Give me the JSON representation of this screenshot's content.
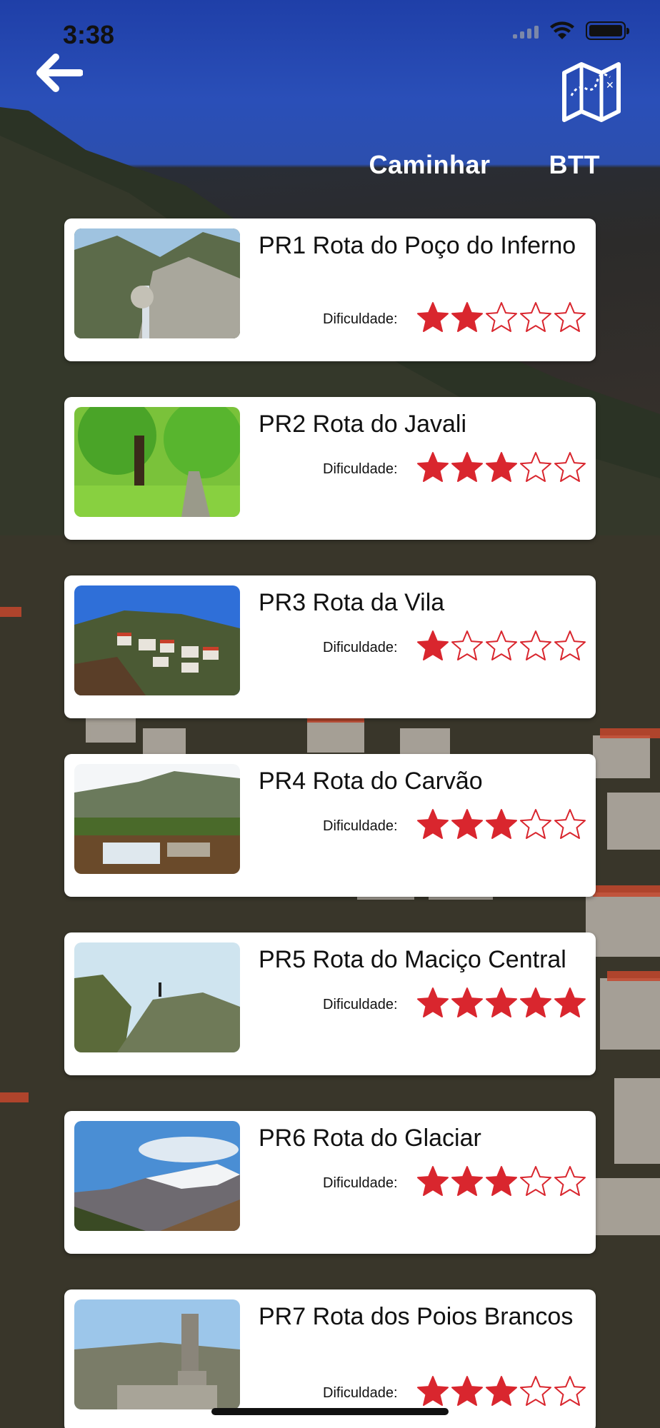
{
  "status": {
    "time": "3:38"
  },
  "nav": {
    "back_icon": "arrow-left-icon",
    "map_icon": "folded-map-icon",
    "tabs": [
      "Caminhar",
      "BTT"
    ]
  },
  "routes": [
    {
      "title": "PR1 Rota do Poço do Inferno",
      "difficulty_label": "Dificuldade:",
      "difficulty": 2,
      "max_difficulty": 5
    },
    {
      "title": "PR2 Rota do Javali",
      "difficulty_label": "Dificuldade:",
      "difficulty": 3,
      "max_difficulty": 5
    },
    {
      "title": "PR3 Rota da Vila",
      "difficulty_label": "Dificuldade:",
      "difficulty": 1,
      "max_difficulty": 5
    },
    {
      "title": "PR4 Rota do Carvão",
      "difficulty_label": "Dificuldade:",
      "difficulty": 3,
      "max_difficulty": 5
    },
    {
      "title": "PR5 Rota do Maciço Central",
      "difficulty_label": "Dificuldade:",
      "difficulty": 5,
      "max_difficulty": 5
    },
    {
      "title": "PR6 Rota do Glaciar",
      "difficulty_label": "Dificuldade:",
      "difficulty": 3,
      "max_difficulty": 5
    },
    {
      "title": "PR7 Rota dos Poios Brancos",
      "difficulty_label": "Dificuldade:",
      "difficulty": 3,
      "max_difficulty": 5
    }
  ],
  "colors": {
    "star": "#d9262e",
    "header_blue": "#2a4fb8"
  }
}
